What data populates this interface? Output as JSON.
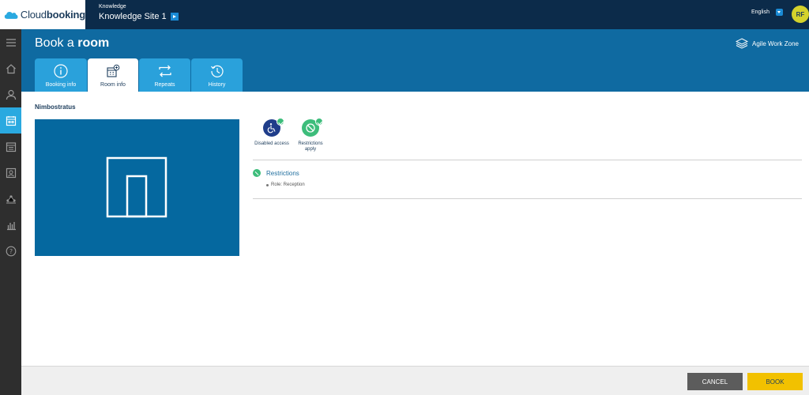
{
  "header": {
    "logo": {
      "prefix": "Cloud",
      "suffix": "booking"
    },
    "site_label": "Knowledge",
    "site_name": "Knowledge Site 1",
    "language": "English",
    "user_initials": "RF"
  },
  "sidebar": {
    "items": [
      {
        "icon": "menu-icon",
        "active": false
      },
      {
        "icon": "home-icon",
        "active": false
      },
      {
        "icon": "user-icon",
        "active": false
      },
      {
        "icon": "calendar-book-icon",
        "active": true
      },
      {
        "icon": "calendar-list-icon",
        "active": false
      },
      {
        "icon": "contact-card-icon",
        "active": false
      },
      {
        "icon": "flow-icon",
        "active": false
      },
      {
        "icon": "bar-chart-icon",
        "active": false
      },
      {
        "icon": "help-icon",
        "active": false
      }
    ]
  },
  "page": {
    "title_prefix": "Book a ",
    "title_bold": "room",
    "zone": "Agile Work Zone"
  },
  "tabs": [
    {
      "label": "Booking info",
      "icon": "info-icon",
      "active": false
    },
    {
      "label": "Room info",
      "icon": "room-info-icon",
      "active": true
    },
    {
      "label": "Repeats",
      "icon": "repeat-icon",
      "active": false
    },
    {
      "label": "History",
      "icon": "history-icon",
      "active": false
    }
  ],
  "room": {
    "name": "Nimbostratus",
    "image_icon": "door-icon"
  },
  "features": [
    {
      "label": "Disabled access",
      "icon": "wheelchair-icon",
      "color": "#1f3d8a",
      "checked": true
    },
    {
      "label": "Restrictions apply",
      "icon": "restricted-icon",
      "color": "#3dbd7b",
      "checked": true
    }
  ],
  "restrictions": {
    "title": "Restrictions",
    "items": [
      "Role: Reception"
    ]
  },
  "footer": {
    "cancel_label": "CANCEL",
    "book_label": "BOOK"
  },
  "colors": {
    "topbar": "#0c2b4a",
    "band": "#0f6aa1",
    "tab": "#2aa1db",
    "sidebar_active": "#2aa9e0",
    "book": "#f2c100",
    "cancel": "#5c5c5c"
  }
}
